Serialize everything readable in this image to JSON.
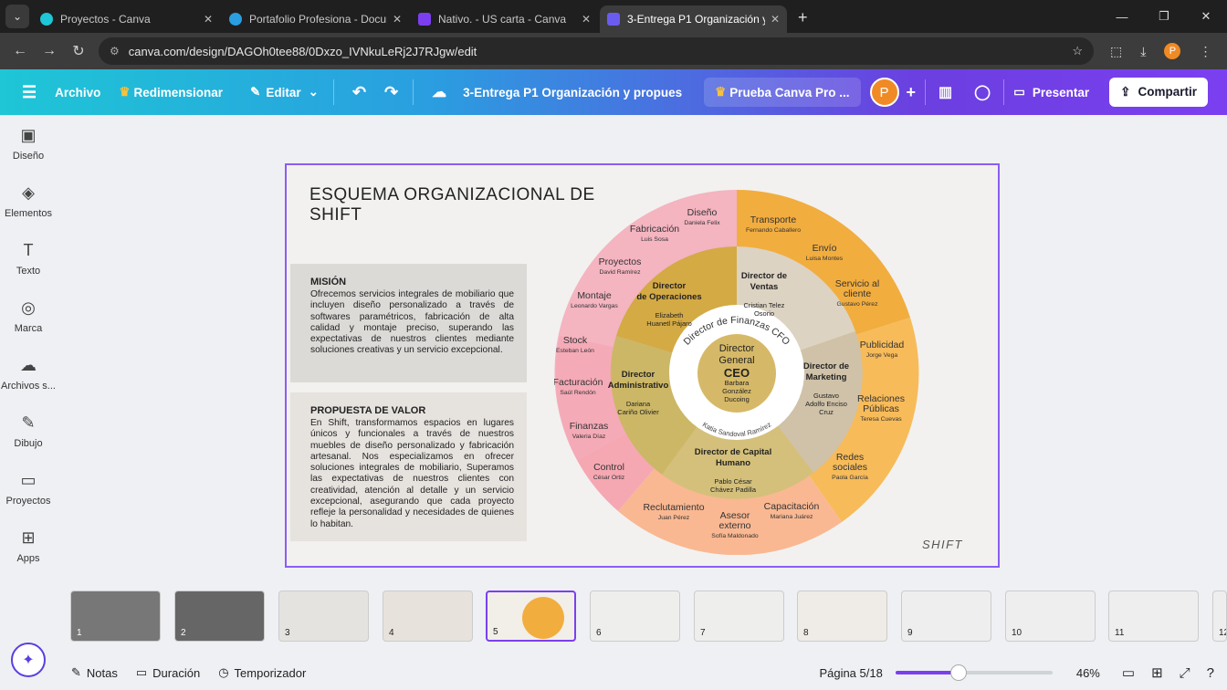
{
  "browser": {
    "tabs": [
      {
        "title": "Proyectos - Canva",
        "active": false
      },
      {
        "title": "Portafolio Profesiona - Docume",
        "active": false
      },
      {
        "title": "Nativo. - US carta - Canva",
        "active": false
      },
      {
        "title": "3-Entrega P1 Organización y pr",
        "active": true
      }
    ],
    "url": "canva.com/design/DAGOh0tee88/0Dxzo_IVNkuLeRj2J7RJgw/edit",
    "profile_initial": "P"
  },
  "toolbar": {
    "archivo": "Archivo",
    "redimensionar": "Redimensionar",
    "editar": "Editar",
    "doc_title": "3-Entrega P1 Organización y propues...",
    "pro": "Prueba Canva Pro ...",
    "avatar": "P",
    "presentar": "Presentar",
    "compartir": "Compartir"
  },
  "rail": [
    {
      "label": "Diseño",
      "icon": "layout-icon"
    },
    {
      "label": "Elementos",
      "icon": "shapes-icon"
    },
    {
      "label": "Texto",
      "icon": "text-icon"
    },
    {
      "label": "Marca",
      "icon": "brand-icon"
    },
    {
      "label": "Archivos s...",
      "icon": "cloud-upload-icon"
    },
    {
      "label": "Dibujo",
      "icon": "pen-icon"
    },
    {
      "label": "Proyectos",
      "icon": "folder-icon"
    },
    {
      "label": "Apps",
      "icon": "apps-icon"
    }
  ],
  "slide": {
    "title": "ESQUEMA ORGANIZACIONAL DE SHIFT",
    "mision_title": "MISIÓN",
    "mision_text": "Ofrecemos servicios integrales de mobiliario que incluyen diseño personalizado a través de softwares paramétricos, fabricación de alta calidad y montaje preciso, superando las expectativas de nuestros clientes mediante soluciones creativas y un servicio excepcional.",
    "valor_title": "PROPUESTA DE VALOR",
    "valor_text": "En Shift, transformamos espacios en lugares únicos y funcionales a través de nuestros muebles de diseño personalizado y fabricación artesanal. Nos especializamos en ofrecer soluciones integrales de mobiliario, Superamos las expectativas de nuestros clientes con creatividad, atención al detalle y un servicio excepcional, asegurando que cada proyecto refleje la personalidad y necesidades de quienes lo habitan.",
    "brand": "SHIFT",
    "ceo": {
      "line1": "Director",
      "line2": "General",
      "line3": "CEO",
      "person": [
        "Barbara",
        "González",
        "Ducoing"
      ]
    },
    "cfo": {
      "label": "Director de Finanzas CFO",
      "person": "Katia Sandoval Ramírez"
    },
    "directors": [
      {
        "title": [
          "Director",
          "de Operaciones"
        ],
        "person": [
          "Elizabeth",
          "Huanetl Pájaro"
        ]
      },
      {
        "title": [
          "Director de",
          "Ventas"
        ],
        "person": [
          "Cristian Telez",
          "Osorio"
        ]
      },
      {
        "title": [
          "Director de",
          "Marketing"
        ],
        "person": [
          "Gustavo",
          "Adolfo Enciso",
          "Cruz"
        ]
      },
      {
        "title": [
          "Director de Capital",
          "Humano"
        ],
        "person": [
          "Pablo César",
          "Chávez Padilla"
        ]
      },
      {
        "title": [
          "Director",
          "Administrativo"
        ],
        "person": [
          "Dariana",
          "Cariño Olivier"
        ]
      }
    ],
    "outer": [
      {
        "role": "Diseño",
        "person": "Daniela Felix"
      },
      {
        "role": "Fabricación",
        "person": "Luis Sosa"
      },
      {
        "role": "Proyectos",
        "person": "David Ramírez"
      },
      {
        "role": "Montaje",
        "person": "Leonardo Vargas"
      },
      {
        "role": "Transporte",
        "person": "Fernando Caballero"
      },
      {
        "role": "Envío",
        "person": "Luisa Montes"
      },
      {
        "role": "Servicio al cliente",
        "person": "Gustavo Pérez"
      },
      {
        "role": "Publicidad",
        "person": "Jorge Vega"
      },
      {
        "role": "Relaciones Públicas",
        "person": "Teresa Cuevas"
      },
      {
        "role": "Redes sociales",
        "person": "Paola García"
      },
      {
        "role": "Capacitación",
        "person": "Mariana Juárez"
      },
      {
        "role": "Asesor externo",
        "person": "Sofía Maldonado"
      },
      {
        "role": "Reclutamiento",
        "person": "Juan Pérez"
      },
      {
        "role": "Stock",
        "person": "Esteban León"
      },
      {
        "role": "Facturación",
        "person": "Saúl Rendón"
      },
      {
        "role": "Finanzas",
        "person": "Valeria Díaz"
      },
      {
        "role": "Control",
        "person": "César Ortiz"
      }
    ],
    "colors": {
      "pink": "#f4b4c0",
      "orange": "#f4b556",
      "peach": "#f9b892",
      "mustard": "#d4aa45",
      "beige": "#ddd3c2",
      "olive": "#d4c07a",
      "khaki": "#c8b57a"
    }
  },
  "thumbnails": [
    "1",
    "2",
    "3",
    "4",
    "5",
    "6",
    "7",
    "8",
    "9",
    "10",
    "11",
    "12"
  ],
  "footer": {
    "notas": "Notas",
    "duracion": "Duración",
    "temporizador": "Temporizador",
    "pagina": "Página 5/18",
    "zoom": "46%",
    "zoom_fraction": 0.4
  }
}
